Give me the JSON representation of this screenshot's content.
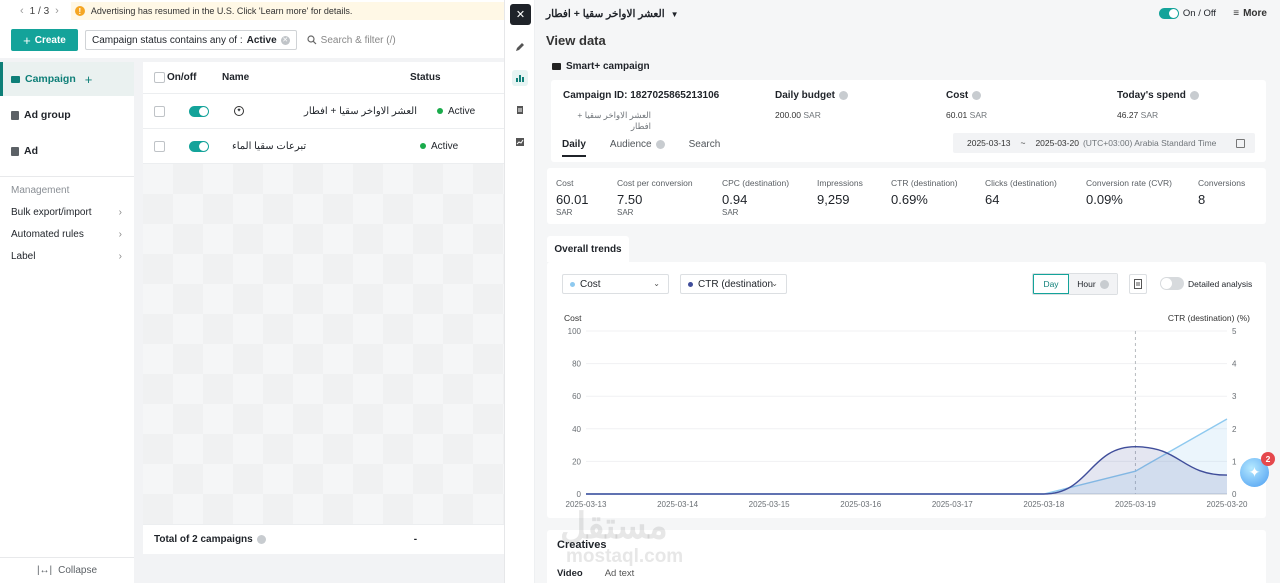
{
  "topbar": {
    "pager_text": "1 / 3",
    "banner_text": "Advertising has resumed in the U.S. Click 'Learn more' for details."
  },
  "toolbar": {
    "create_label": "Create",
    "filter_prefix": "Campaign status contains any of :",
    "filter_value": "Active",
    "search_placeholder": "Search & filter (/)"
  },
  "sidebar": {
    "items": [
      {
        "label": "Campaign"
      },
      {
        "label": "Ad group"
      },
      {
        "label": "Ad"
      }
    ],
    "management_title": "Management",
    "management_items": [
      {
        "label": "Bulk export/import"
      },
      {
        "label": "Automated rules"
      },
      {
        "label": "Label"
      }
    ],
    "collapse_label": "Collapse"
  },
  "table": {
    "columns": [
      "On/off",
      "Name",
      "Status"
    ],
    "rows": [
      {
        "name": "العشر الاواخر سقيا + افطار",
        "status": "Active",
        "on": true
      },
      {
        "name": "تبرعات سقيا الماء",
        "status": "Active",
        "on": true
      }
    ],
    "total_label": "Total of 2 campaigns",
    "total_status": "-"
  },
  "drawer": {
    "title": "العشر الاواخر سقيا + افطار",
    "onoff_label": "On / Off",
    "more_label": "More",
    "view_title": "View data",
    "section_title": "Smart+ campaign",
    "campaign_id_label": "Campaign ID: 1827025865213106",
    "campaign_name": "العشر الاواخر سقيا + افطار",
    "daily_budget_label": "Daily budget",
    "daily_budget_value": "200.00",
    "cost_label": "Cost",
    "cost_value": "60.01",
    "todays_spend_label": "Today's spend",
    "todays_spend_value": "46.27",
    "currency": "SAR",
    "tabs": [
      "Daily",
      "Audience",
      "Search"
    ],
    "date_from": "2025-03-13",
    "date_sep": "~",
    "date_to": "2025-03-20",
    "timezone": "(UTC+03:00) Arabia Standard Time",
    "metrics": [
      {
        "label": "Cost",
        "value": "60.01",
        "unit": "SAR"
      },
      {
        "label": "Cost per conversion",
        "value": "7.50",
        "unit": "SAR"
      },
      {
        "label": "CPC (destination)",
        "value": "0.94",
        "unit": "SAR"
      },
      {
        "label": "Impressions",
        "value": "9,259",
        "unit": ""
      },
      {
        "label": "CTR (destination)",
        "value": "0.69%",
        "unit": ""
      },
      {
        "label": "Clicks (destination)",
        "value": "64",
        "unit": ""
      },
      {
        "label": "Conversion rate (CVR)",
        "value": "0.09%",
        "unit": ""
      },
      {
        "label": "Conversions",
        "value": "8",
        "unit": ""
      }
    ],
    "trends_tab": "Overall trends",
    "metric_select_1": "Cost",
    "metric_select_2": "CTR (destination",
    "granularity": [
      "Day",
      "Hour"
    ],
    "detailed_analysis": "Detailed analysis",
    "creatives_title": "Creatives",
    "creatives_tabs": [
      "Video",
      "Ad text"
    ]
  },
  "colors": {
    "accent": "#14a39a",
    "cost_series": "#8ec9ef",
    "ctr_series": "#3f4d9a"
  },
  "watermark": {
    "line1": "مستقل",
    "line2": "mostaql.com"
  },
  "assistant_badge": "2",
  "chart_data": {
    "type": "area",
    "x": [
      "2025-03-13",
      "2025-03-14",
      "2025-03-15",
      "2025-03-16",
      "2025-03-17",
      "2025-03-18",
      "2025-03-19",
      "2025-03-20"
    ],
    "series": [
      {
        "name": "Cost",
        "axis": "left",
        "values": [
          0,
          0,
          0,
          0,
          0,
          0,
          14,
          46
        ],
        "color": "#8ec9ef"
      },
      {
        "name": "CTR (destination) (%)",
        "axis": "right",
        "values": [
          0,
          0,
          0,
          0,
          0,
          0,
          1.45,
          0.58
        ],
        "color": "#3f4d9a"
      }
    ],
    "ylabel_left": "Cost",
    "ylabel_right": "CTR (destination) (%)",
    "ylim_left": [
      0,
      100
    ],
    "ylim_right": [
      0,
      5
    ],
    "yticks_left": [
      "100",
      "80",
      "60",
      "40",
      "20",
      "0"
    ],
    "yticks_right": [
      "5",
      "4",
      "3",
      "2",
      "1",
      "0"
    ],
    "marker_x": "2025-03-19"
  }
}
